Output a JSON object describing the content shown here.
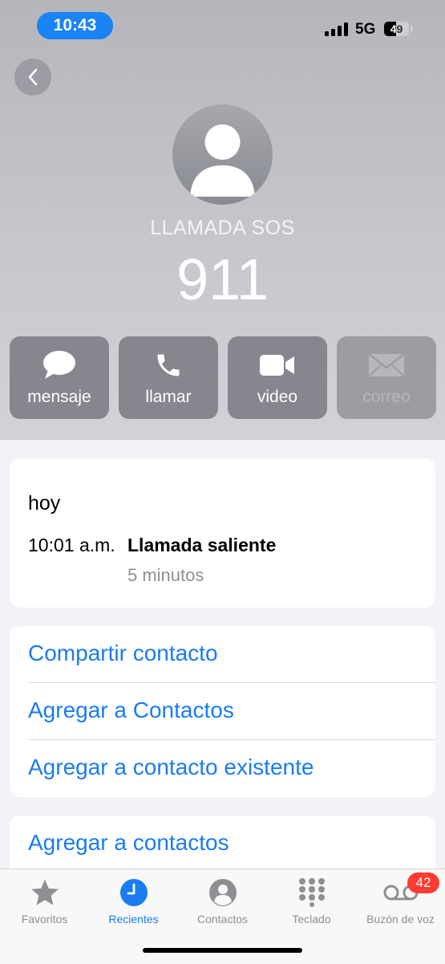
{
  "status_bar": {
    "time": "10:43",
    "network": "5G",
    "battery": "49",
    "battery_level": 49
  },
  "contact": {
    "label": "LLAMADA SOS",
    "number": "911"
  },
  "actions": [
    {
      "label": "mensaje",
      "icon": "message-bubble-icon",
      "enabled": true
    },
    {
      "label": "llamar",
      "icon": "phone-icon",
      "enabled": true
    },
    {
      "label": "video",
      "icon": "video-camera-icon",
      "enabled": true
    },
    {
      "label": "correo",
      "icon": "mail-envelope-icon",
      "enabled": false
    }
  ],
  "recents": {
    "day": "hoy",
    "entries": [
      {
        "time": "10:01 a.m.",
        "type": "Llamada saliente",
        "duration": "5 minutos"
      }
    ]
  },
  "options": [
    "Compartir contacto",
    "Agregar a Contactos",
    "Agregar a contacto existente"
  ],
  "more_options": [
    "Agregar a contactos"
  ],
  "tabbar": {
    "tabs": [
      {
        "label": "Favoritos",
        "icon": "star-icon",
        "active": false
      },
      {
        "label": "Recientes",
        "icon": "clock-icon",
        "active": true
      },
      {
        "label": "Contactos",
        "icon": "person-circle-icon",
        "active": false
      },
      {
        "label": "Teclado",
        "icon": "keypad-icon",
        "active": false
      },
      {
        "label": "Buzón de voz",
        "icon": "voicemail-icon",
        "active": false
      }
    ],
    "voicemail_badge": "42"
  },
  "colors": {
    "accent": "#1a7cf0",
    "badge": "#ff3b30",
    "time_pill": "#1a84f5"
  }
}
